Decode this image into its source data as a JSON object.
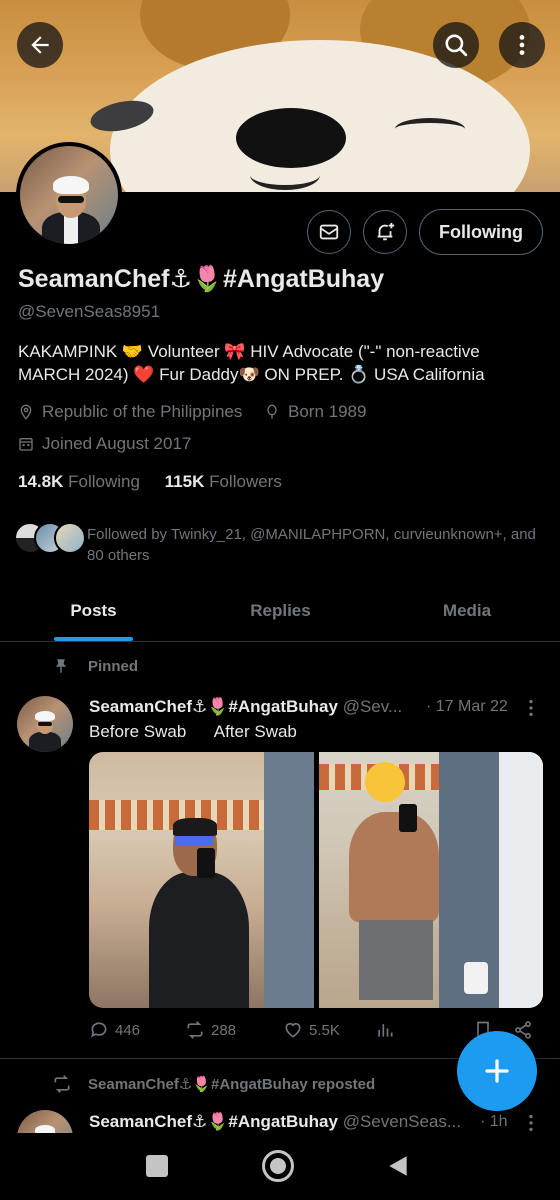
{
  "profile": {
    "display_name": "SeamanChef⚓🌷#AngatBuhay",
    "handle": "@SevenSeas8951",
    "bio_line1": "KAKAMPINK 🤝 Volunteer 🎀 HIV Advocate (\"-\" non-reactive",
    "bio_line2": "MARCH 2024) ❤️ Fur Daddy🐶 ON PREP. 💍 USA California",
    "location": "Republic of the Philippines",
    "born": "Born 1989",
    "joined": "Joined August 2017",
    "following_count": "14.8K",
    "following_label": "Following",
    "followers_count": "115K",
    "followers_label": "Followers",
    "followed_by_line1": "Followed by Twinky_21, @MANILAPHPORN, curvieunknown+, and",
    "followed_by_line2": "80 others"
  },
  "header": {
    "follow_button_label": "Following",
    "back_icon": "arrow-left-icon",
    "search_icon": "search-icon",
    "more_icon": "more-vertical-icon"
  },
  "tabs": [
    {
      "label": "Posts",
      "active": true
    },
    {
      "label": "Replies",
      "active": false
    },
    {
      "label": "Media",
      "active": false
    }
  ],
  "pinned_post": {
    "pinned_label": "Pinned",
    "author_name": "SeamanChef⚓🌷#AngatBuhay",
    "author_handle": "@Sev...",
    "time": "· 17 Mar 22",
    "text": "Before Swab      After Swab",
    "replies": "446",
    "reposts": "288",
    "likes": "5.5K"
  },
  "repost": {
    "label": "SeamanChef⚓🌷#AngatBuhay reposted",
    "author_name": "SeamanChef⚓🌷#AngatBuhay",
    "author_handle": "@SevenSeas...",
    "time": "· 1h"
  },
  "colors": {
    "accent": "#1d9bf0",
    "muted_text": "#71767b",
    "border": "#2f3336",
    "background": "#000000"
  }
}
